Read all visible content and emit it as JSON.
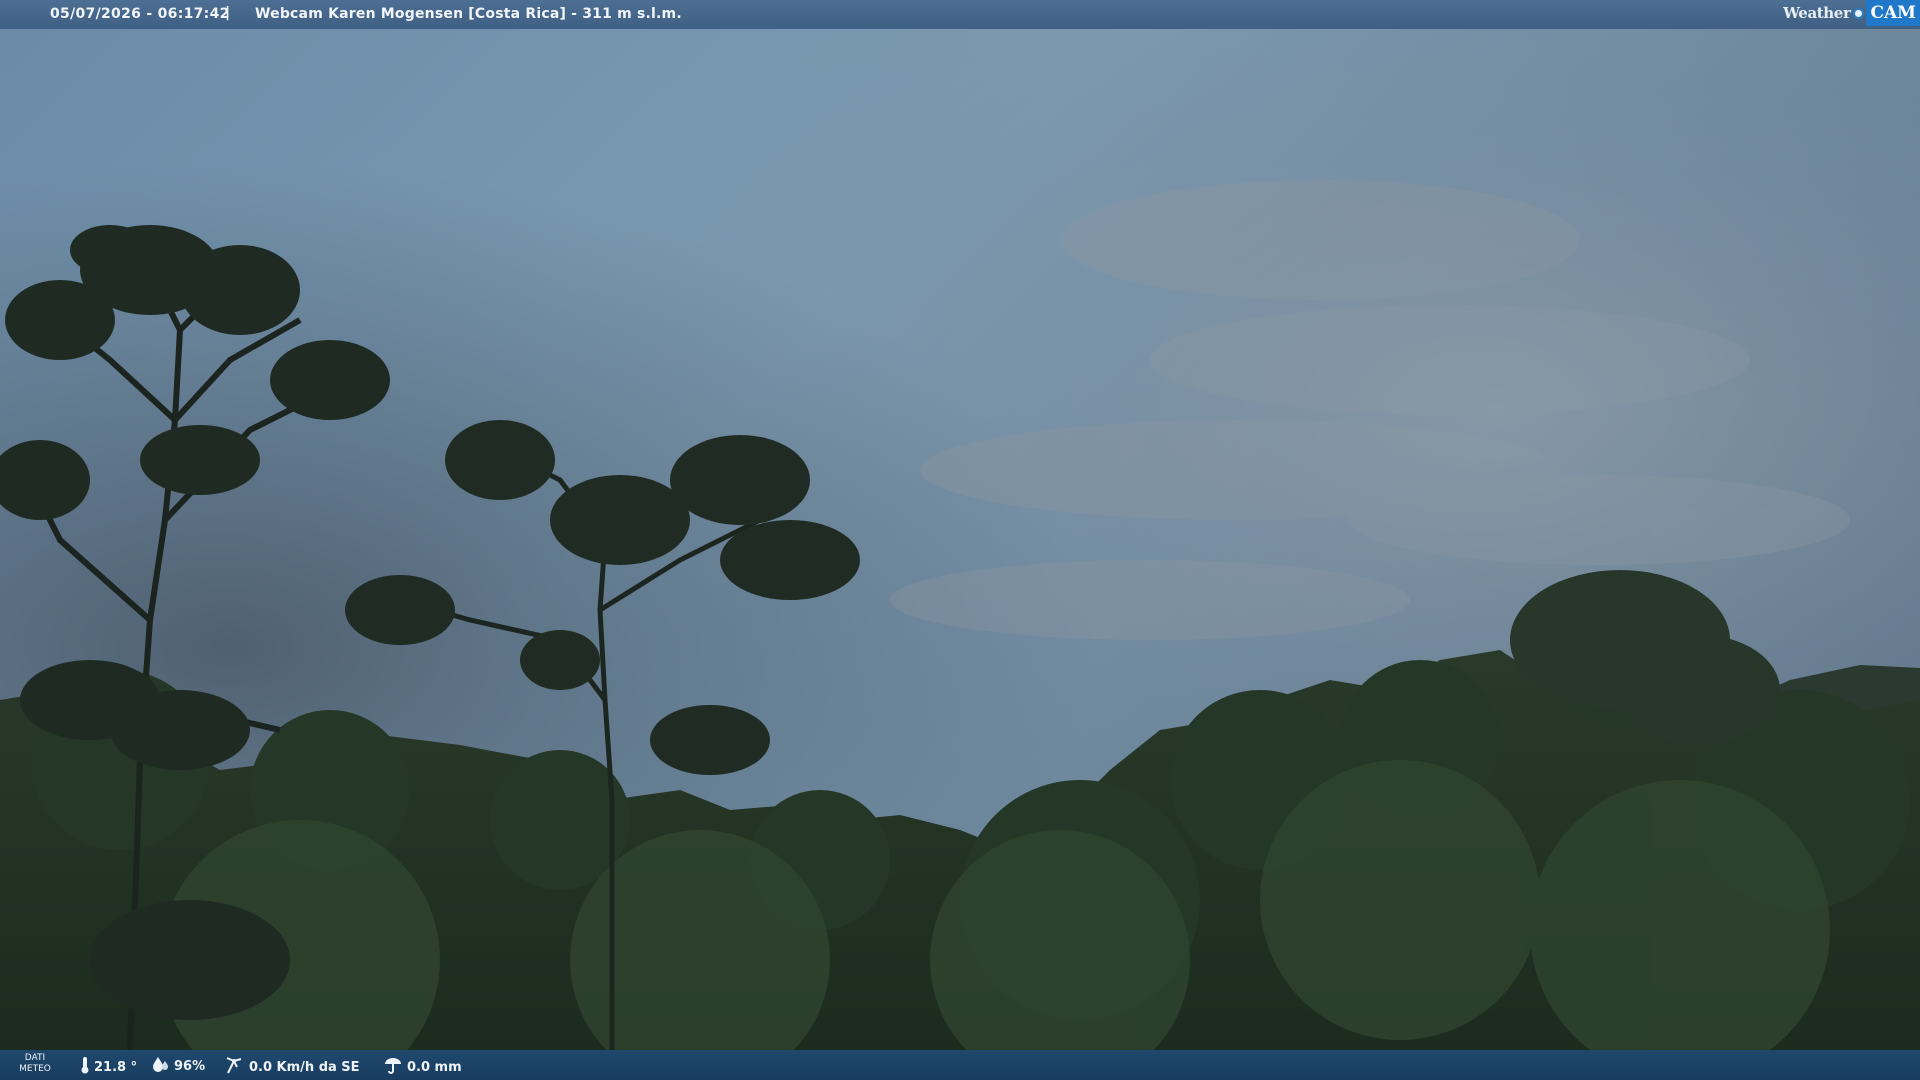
{
  "header": {
    "datetime": "05/07/2026 - 06:17:42",
    "separator": "|",
    "title": "Webcam Karen Mogensen [Costa Rica] - 311 m s.l.m."
  },
  "logo": {
    "word": "Weather",
    "cam": "CAM"
  },
  "meteo": {
    "label_line1": "DATI",
    "label_line2": "METEO",
    "temperature": "21.8 °",
    "humidity": "96%",
    "wind": "0.0 Km/h da SE",
    "rain": "0.0 mm"
  },
  "icons": [
    "thermometer-icon",
    "humidity-drop-icon",
    "wind-icon",
    "rain-gauge-icon"
  ],
  "colors": {
    "topbar": "#46678c",
    "bottombar": "#1c4266",
    "logo_accent": "#1f78c8"
  }
}
